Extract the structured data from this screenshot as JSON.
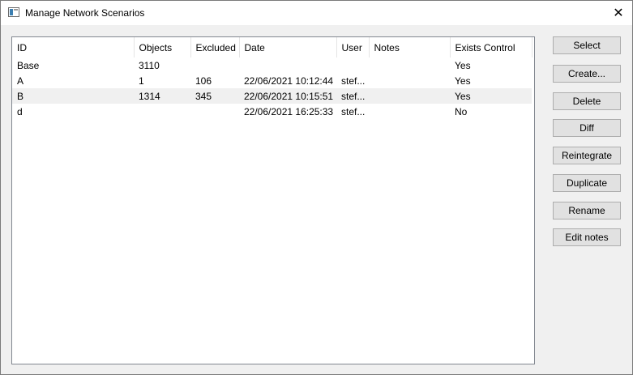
{
  "window": {
    "title": "Manage Network Scenarios",
    "close_glyph": "✕"
  },
  "table": {
    "columns": [
      "ID",
      "Objects",
      "Excluded",
      "Date",
      "User",
      "Notes",
      "Exists Control"
    ],
    "rows": [
      [
        "Base",
        "3110",
        "",
        "",
        "",
        "",
        "Yes"
      ],
      [
        "A",
        "1",
        "106",
        "22/06/2021 10:12:44",
        "stef...",
        "",
        "Yes"
      ],
      [
        "B",
        "1314",
        "345",
        "22/06/2021 10:15:51",
        "stef...",
        "",
        "Yes"
      ],
      [
        "d",
        "",
        "",
        "22/06/2021 16:25:33",
        "stef...",
        "",
        "No"
      ]
    ],
    "selected_row": 2
  },
  "buttons": {
    "select": "Select",
    "create": "Create...",
    "delete": "Delete",
    "diff": "Diff",
    "reintegrate": "Reintegrate",
    "duplicate": "Duplicate",
    "rename": "Rename",
    "edit_notes": "Edit notes"
  },
  "icons": {
    "app": "window-icon",
    "close": "close-icon"
  }
}
